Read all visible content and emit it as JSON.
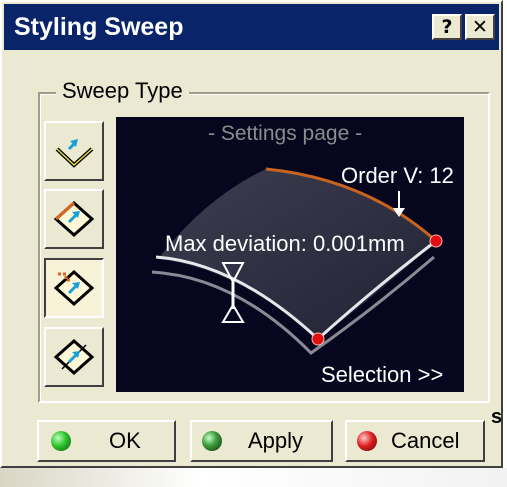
{
  "window": {
    "title": "Styling Sweep",
    "help_button": "?",
    "close_button": "✕"
  },
  "sweep_type": {
    "legend": "Sweep Type",
    "buttons": [
      {
        "icon": "sweep-explicit-icon",
        "state": "normal"
      },
      {
        "icon": "sweep-spine-icon",
        "state": "normal"
      },
      {
        "icon": "sweep-limits-icon",
        "state": "pressed"
      },
      {
        "icon": "sweep-profile-icon",
        "state": "normal"
      }
    ]
  },
  "preview": {
    "settings_label": "- Settings page -",
    "order_label": "Order V: 12",
    "max_deviation_label": "Max deviation: 0.001mm",
    "selection_link": "Selection >>",
    "colors": {
      "background": "#06061f",
      "accent_curve": "#c8641e",
      "point": "#e01010"
    }
  },
  "buttons": {
    "ok": "OK",
    "apply": "Apply",
    "cancel": "Cancel"
  },
  "edge_fragment": "s"
}
